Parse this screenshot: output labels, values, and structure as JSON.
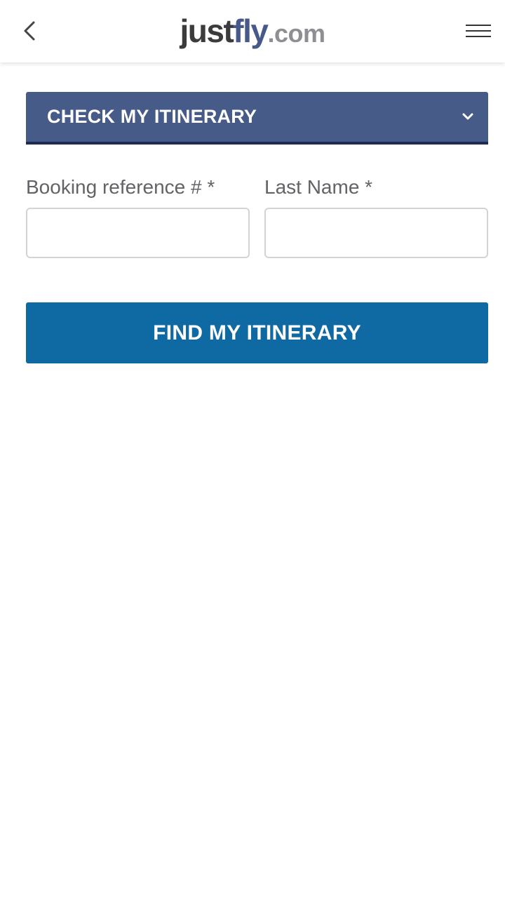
{
  "header": {
    "logo": {
      "just": "just",
      "fly": "fly",
      "dotcom": ".com"
    },
    "icons": {
      "back": "chevron-left-icon",
      "menu": "hamburger-menu-icon"
    }
  },
  "dropdown": {
    "label": "CHECK MY ITINERARY",
    "icon": "chevron-down-icon"
  },
  "form": {
    "booking_reference": {
      "label": "Booking reference # *",
      "value": "",
      "placeholder": ""
    },
    "last_name": {
      "label": "Last Name *",
      "value": "",
      "placeholder": ""
    }
  },
  "submit": {
    "label": "FIND MY ITINERARY"
  },
  "colors": {
    "brand_dark": "#3a3b3d",
    "brand_blue": "#46598a",
    "dropdown_bg": "#475b88",
    "dropdown_border": "#1d2a52",
    "button_bg": "#0f69a3",
    "label_text": "#616366"
  }
}
